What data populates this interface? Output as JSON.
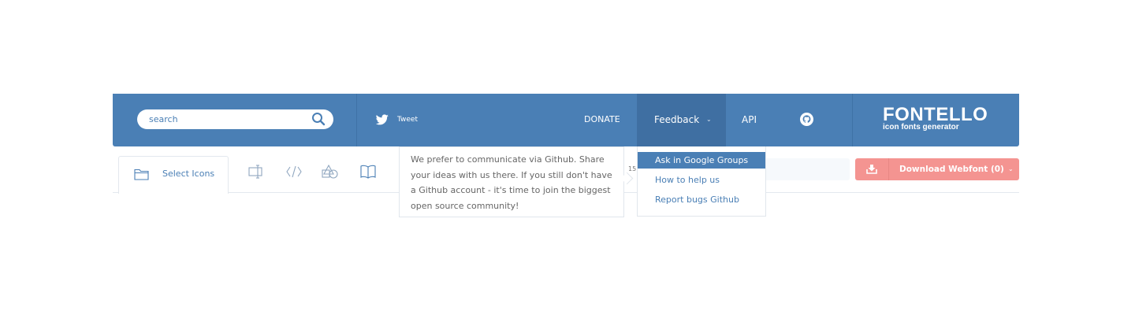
{
  "header": {
    "search_placeholder": "search",
    "tweet_label": "Tweet",
    "nav": {
      "donate": "DONATE",
      "feedback": "Feedback",
      "api": "API"
    },
    "logo_title": "FONTELLO",
    "logo_subtitle": "icon fonts generator"
  },
  "tabs": {
    "select_icons_label": "Select Icons",
    "icons": [
      "folder-icon",
      "customize-names-icon",
      "customize-codes-icon",
      "shapes-icon",
      "book-icon"
    ]
  },
  "popover": {
    "text": "We prefer to communicate via Github. Share your ideas with us there. If you still don't have a Github account - it's time to join the biggest open source community!"
  },
  "feedback_menu": {
    "items": [
      {
        "label": "Ask in Google Groups",
        "active": true
      },
      {
        "label": "How to help us",
        "active": false
      },
      {
        "label": "Report bugs Github",
        "active": false
      }
    ]
  },
  "counter_text": "15",
  "download_button": {
    "label": "Download Webfont (0)"
  },
  "colors": {
    "header_bg": "#4a7fb5",
    "download_bg": "#f49491",
    "accent_text": "#4a7fb5"
  }
}
